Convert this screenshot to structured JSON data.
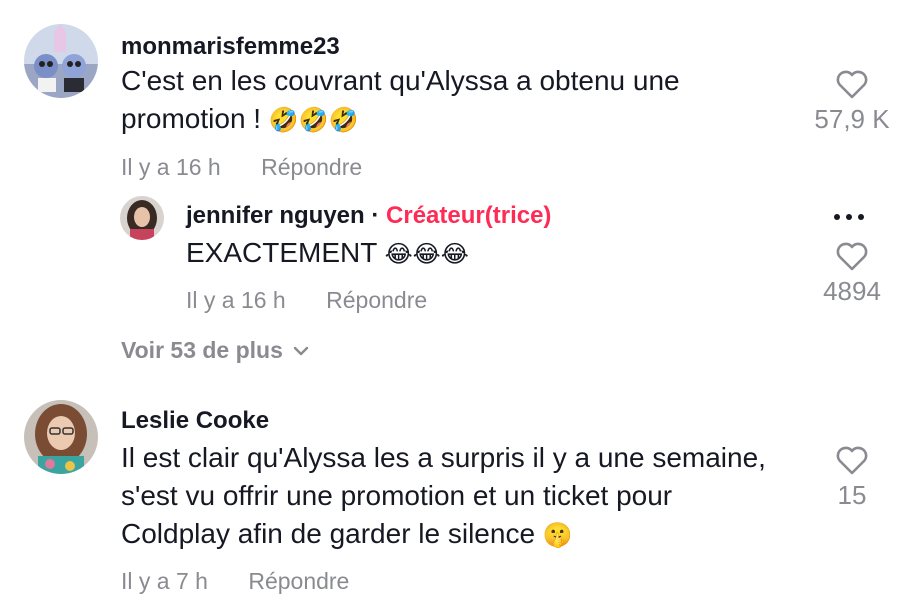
{
  "comments": [
    {
      "username": "monmarisfemme23",
      "text": "C'est en les couvrant qu'Alyssa a obtenu une promotion !",
      "emoji": "🤣🤣🤣",
      "time": "Il y a 16 h",
      "reply_label": "Répondre",
      "likes": "57,9 K"
    },
    {
      "username": "Leslie Cooke",
      "text_lines": [
        "Il est clair qu'Alyssa les a surpris il y a une semaine,",
        "s'est vu offrir une promotion et un ticket pour",
        "Coldplay afin de garder le silence"
      ],
      "emoji": "🤫",
      "time": "Il y a 7 h",
      "reply_label": "Répondre",
      "likes": "15"
    }
  ],
  "reply": {
    "username": "jennifer nguyen",
    "separator": "·",
    "badge": "Créateur(trice)",
    "text": "EXACTEMENT",
    "emoji": "😂😂😂",
    "time": "Il y a 16 h",
    "reply_label": "Répondre",
    "likes": "4894"
  },
  "view_more": "Voir 53 de plus",
  "icons": {
    "like": "heart-outline-icon",
    "more": "more-options-icon",
    "expand": "chevron-down-icon"
  },
  "colors": {
    "text": "#161823",
    "muted": "#8a8b91",
    "creator_badge": "#fe2c55"
  }
}
